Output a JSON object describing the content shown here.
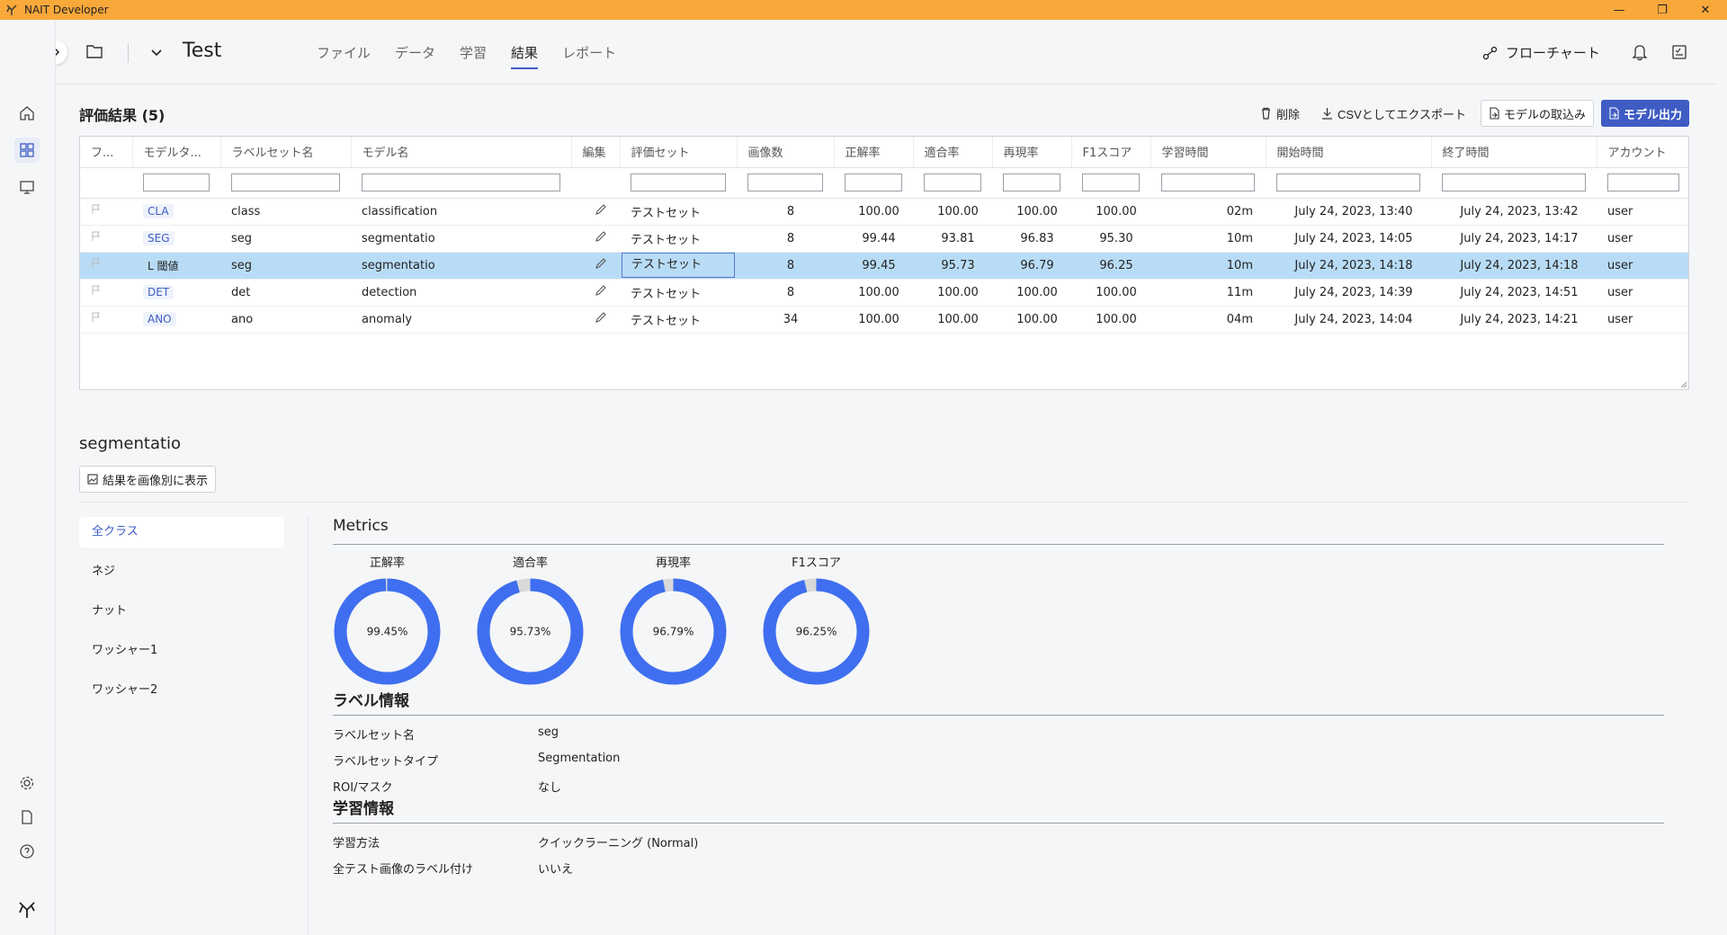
{
  "app": {
    "title": "NAIT Developer"
  },
  "window": {
    "minimize": "—",
    "restore": "❐",
    "close": "✕"
  },
  "header": {
    "project_title": "Test",
    "nav": [
      {
        "label": "ファイル"
      },
      {
        "label": "データ"
      },
      {
        "label": "学習"
      },
      {
        "label": "結果",
        "active": true
      },
      {
        "label": "レポート"
      }
    ],
    "flowchart_label": "フローチャート"
  },
  "results": {
    "title": "評価結果 (5)",
    "toolbar": {
      "delete": "削除",
      "export_csv": "CSVとしてエクスポート",
      "import_model": "モデルの取込み",
      "export_model": "モデル出力"
    },
    "columns": [
      "フ...",
      "モデルタ...",
      "ラベルセット名",
      "モデル名",
      "編集",
      "評価セット",
      "画像数",
      "正解率",
      "適合率",
      "再現率",
      "F1スコア",
      "学習時間",
      "開始時間",
      "終了時間",
      "アカウント"
    ],
    "rows": [
      {
        "tag": "CLA",
        "labelset": "class",
        "model": "classification",
        "evalset": "テストセット",
        "images": "8",
        "accuracy": "100.00",
        "precision": "100.00",
        "recall": "100.00",
        "f1": "100.00",
        "time": "02m",
        "start": "July 24, 2023, 13:40",
        "end": "July 24, 2023, 13:42",
        "account": "user"
      },
      {
        "tag": "SEG",
        "labelset": "seg",
        "model": "segmentatio",
        "evalset": "テストセット",
        "images": "8",
        "accuracy": "99.44",
        "precision": "93.81",
        "recall": "96.83",
        "f1": "95.30",
        "time": "10m",
        "start": "July 24, 2023, 14:05",
        "end": "July 24, 2023, 14:17",
        "account": "user"
      },
      {
        "tag": "L 閾値",
        "labelset": "seg",
        "model": "segmentatio",
        "evalset": "テストセット",
        "images": "8",
        "accuracy": "99.45",
        "precision": "95.73",
        "recall": "96.79",
        "f1": "96.25",
        "time": "10m",
        "start": "July 24, 2023, 14:18",
        "end": "July 24, 2023, 14:18",
        "account": "user",
        "selected": true
      },
      {
        "tag": "DET",
        "labelset": "det",
        "model": "detection",
        "evalset": "テストセット",
        "images": "8",
        "accuracy": "100.00",
        "precision": "100.00",
        "recall": "100.00",
        "f1": "100.00",
        "time": "11m",
        "start": "July 24, 2023, 14:39",
        "end": "July 24, 2023, 14:51",
        "account": "user"
      },
      {
        "tag": "ANO",
        "labelset": "ano",
        "model": "anomaly",
        "evalset": "テストセット",
        "images": "34",
        "accuracy": "100.00",
        "precision": "100.00",
        "recall": "100.00",
        "f1": "100.00",
        "time": "04m",
        "start": "July 24, 2023, 14:04",
        "end": "July 24, 2023, 14:21",
        "account": "user"
      }
    ]
  },
  "detail": {
    "title": "segmentatio",
    "show_by_image": "結果を画像別に表示",
    "classes": [
      "全クラス",
      "ネジ",
      "ナット",
      "ワッシャー1",
      "ワッシャー2"
    ],
    "metrics_title": "Metrics",
    "metrics": [
      {
        "label": "正解率",
        "value": 99.45,
        "text": "99.45%"
      },
      {
        "label": "適合率",
        "value": 95.73,
        "text": "95.73%"
      },
      {
        "label": "再現率",
        "value": 96.79,
        "text": "96.79%"
      },
      {
        "label": "F1スコア",
        "value": 96.25,
        "text": "96.25%"
      }
    ],
    "label_info": {
      "title": "ラベル情報",
      "items": [
        {
          "k": "ラベルセット名",
          "v": "seg"
        },
        {
          "k": "ラベルセットタイプ",
          "v": "Segmentation"
        },
        {
          "k": "ROI/マスク",
          "v": "なし"
        }
      ]
    },
    "train_info": {
      "title": "学習情報",
      "items": [
        {
          "k": "学習方法",
          "v": "クイックラーニング (Normal)"
        },
        {
          "k": "全テスト画像のラベル付け",
          "v": "いいえ"
        }
      ]
    }
  },
  "colors": {
    "accent": "#3e5cc4",
    "titlebar": "#f9a83a",
    "selected_row": "#b9dcf6",
    "donut": "#3f6ff0",
    "donut_rest": "#d9d9d9"
  }
}
